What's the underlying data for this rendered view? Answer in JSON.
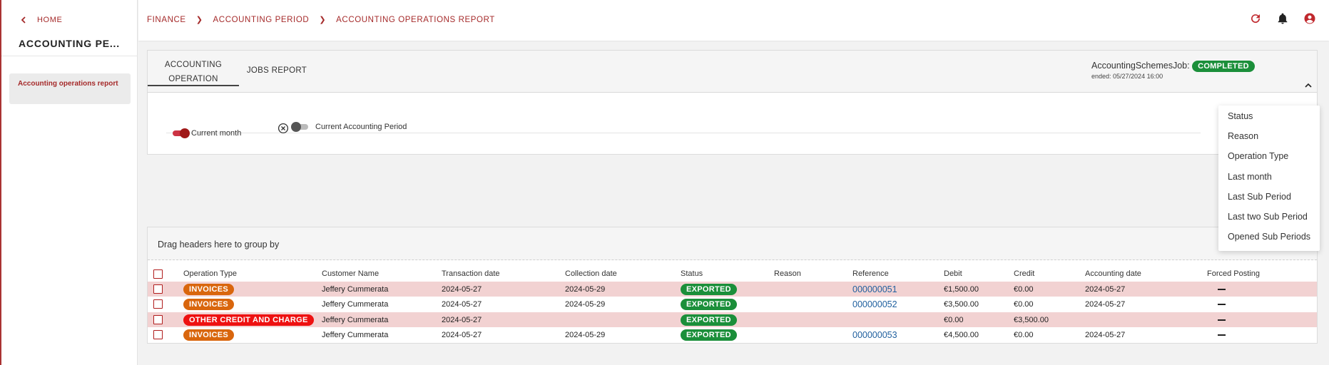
{
  "sidebar": {
    "home_label": "HOME",
    "title": "ACCOUNTING PE...",
    "items": [
      {
        "label": "Accounting operations report"
      }
    ]
  },
  "breadcrumb": [
    "FINANCE",
    "ACCOUNTING PERIOD",
    "ACCOUNTING OPERATIONS REPORT"
  ],
  "tabs": [
    {
      "label": "ACCOUNTING OPERATION",
      "active": true
    },
    {
      "label": "JOBS REPORT",
      "active": false
    }
  ],
  "job": {
    "label": "AccountingSchemesJob:",
    "status": "COMPLETED",
    "ended": "ended: 05/27/2024 16:00"
  },
  "filters": {
    "current_month": "Current month",
    "current_accounting_period": "Current Accounting Period"
  },
  "dropdown": [
    "Status",
    "Reason",
    "Operation Type",
    "Last month",
    "Last Sub Period",
    "Last two Sub Period",
    "Opened Sub Periods"
  ],
  "grid": {
    "group_hint": "Drag headers here to group by",
    "columns": [
      "Operation Type",
      "Customer Name",
      "Transaction date",
      "Collection date",
      "Status",
      "Reason",
      "Reference",
      "Debit",
      "Credit",
      "Accounting date",
      "Forced Posting"
    ],
    "rows": [
      {
        "type": "INVOICES",
        "customer": "Jeffery Cummerata",
        "transaction_date": "2024-05-27",
        "collection_date": "2024-05-29",
        "status": "EXPORTED",
        "reason": "",
        "reference": "000000051",
        "debit": "€1,500.00",
        "credit": "€0.00",
        "accounting_date": "2024-05-27"
      },
      {
        "type": "INVOICES",
        "customer": "Jeffery Cummerata",
        "transaction_date": "2024-05-27",
        "collection_date": "2024-05-29",
        "status": "EXPORTED",
        "reason": "",
        "reference": "000000052",
        "debit": "€3,500.00",
        "credit": "€0.00",
        "accounting_date": "2024-05-27"
      },
      {
        "type": "OTHER CREDIT AND CHARGE",
        "customer": "Jeffery Cummerata",
        "transaction_date": "2024-05-27",
        "collection_date": "",
        "status": "EXPORTED",
        "reason": "",
        "reference": "",
        "debit": "€0.00",
        "credit": "€3,500.00",
        "accounting_date": ""
      },
      {
        "type": "INVOICES",
        "customer": "Jeffery Cummerata",
        "transaction_date": "2024-05-27",
        "collection_date": "2024-05-29",
        "status": "EXPORTED",
        "reason": "",
        "reference": "000000053",
        "debit": "€4,500.00",
        "credit": "€0.00",
        "accounting_date": "2024-05-27"
      }
    ]
  },
  "colors": {
    "brand": "#a52a2a",
    "exported": "#1b8f3a",
    "invoice": "#d9660d",
    "other_credit": "#ee1111",
    "row_highlight": "#f2d2d2"
  },
  "icons": {
    "back": "chevron-left-icon",
    "refresh": "refresh-icon",
    "bell": "bell-icon",
    "account": "account-circle-icon",
    "collapse": "chevron-up-icon",
    "clear": "close-circle-icon"
  }
}
